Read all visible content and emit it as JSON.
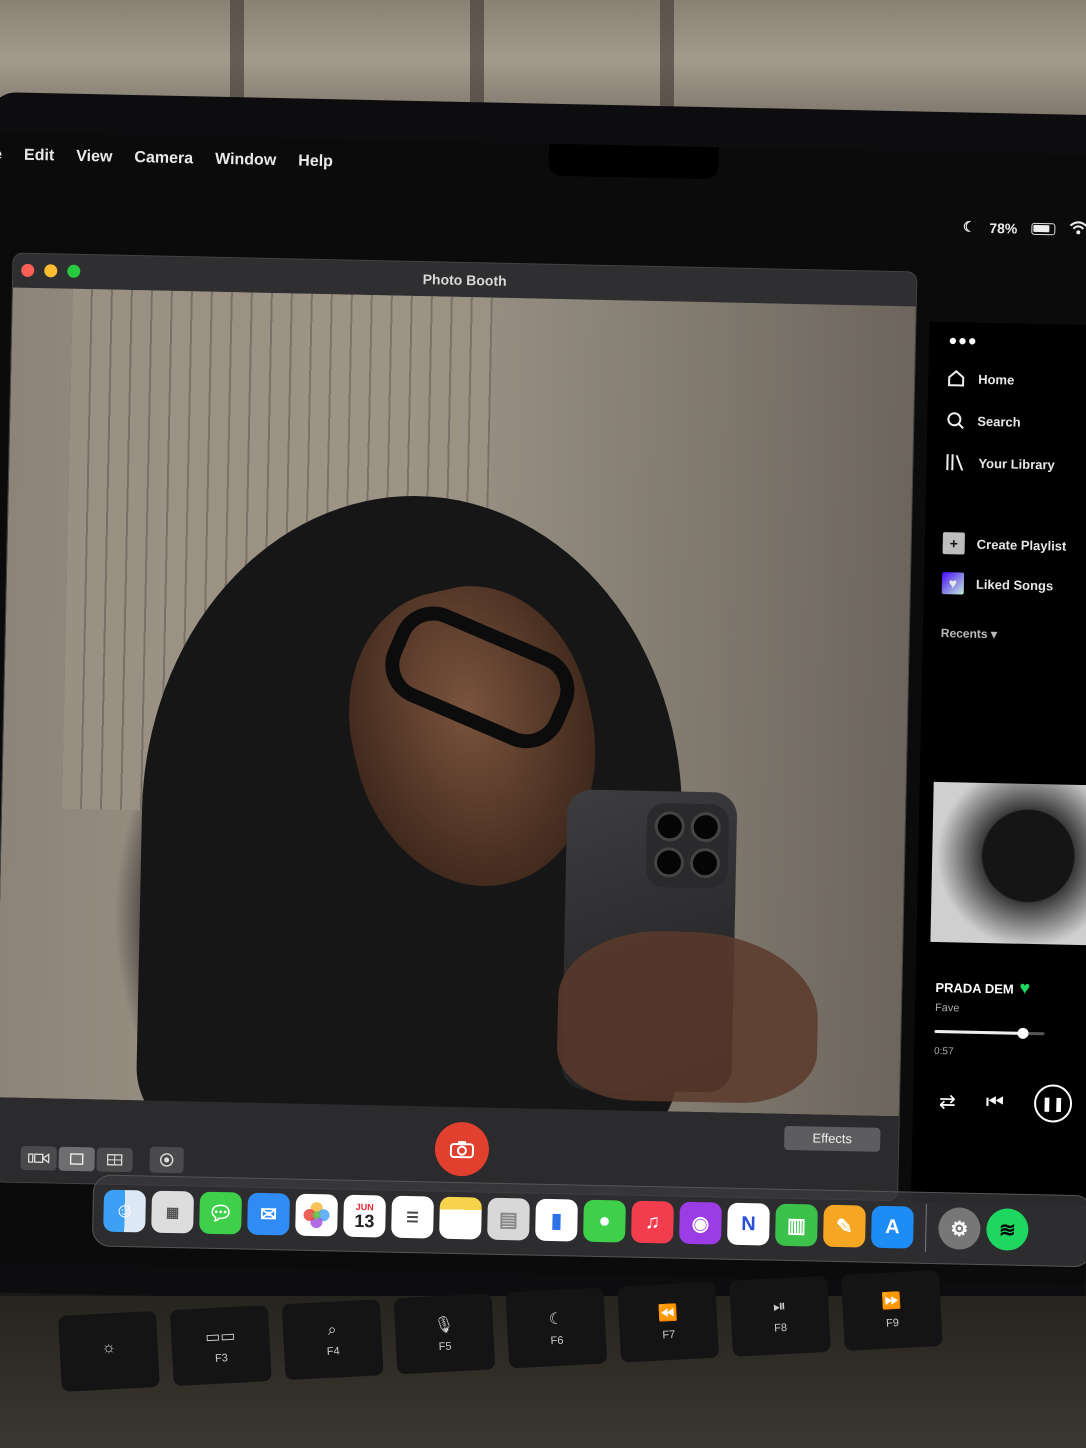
{
  "menubar": {
    "items": [
      "le",
      "Edit",
      "View",
      "Camera",
      "Window",
      "Help"
    ]
  },
  "status": {
    "battery": "78%"
  },
  "photobooth": {
    "title": "Photo Booth",
    "effects_label": "Effects"
  },
  "spotify": {
    "nav": [
      "Home",
      "Search",
      "Your Library"
    ],
    "create_playlist": "Create Playlist",
    "liked_songs": "Liked Songs",
    "recents": "Recents",
    "now_playing": {
      "title": "PRADA DEM",
      "artist": "Fave",
      "elapsed": "0:57",
      "progress": 0.8
    }
  },
  "dock": {
    "calendar_month": "JUN",
    "calendar_day": "13"
  },
  "keyboard": {
    "keys": [
      "",
      "F3",
      "F4",
      "F5",
      "F6",
      "F7",
      "F8",
      "F9"
    ]
  }
}
